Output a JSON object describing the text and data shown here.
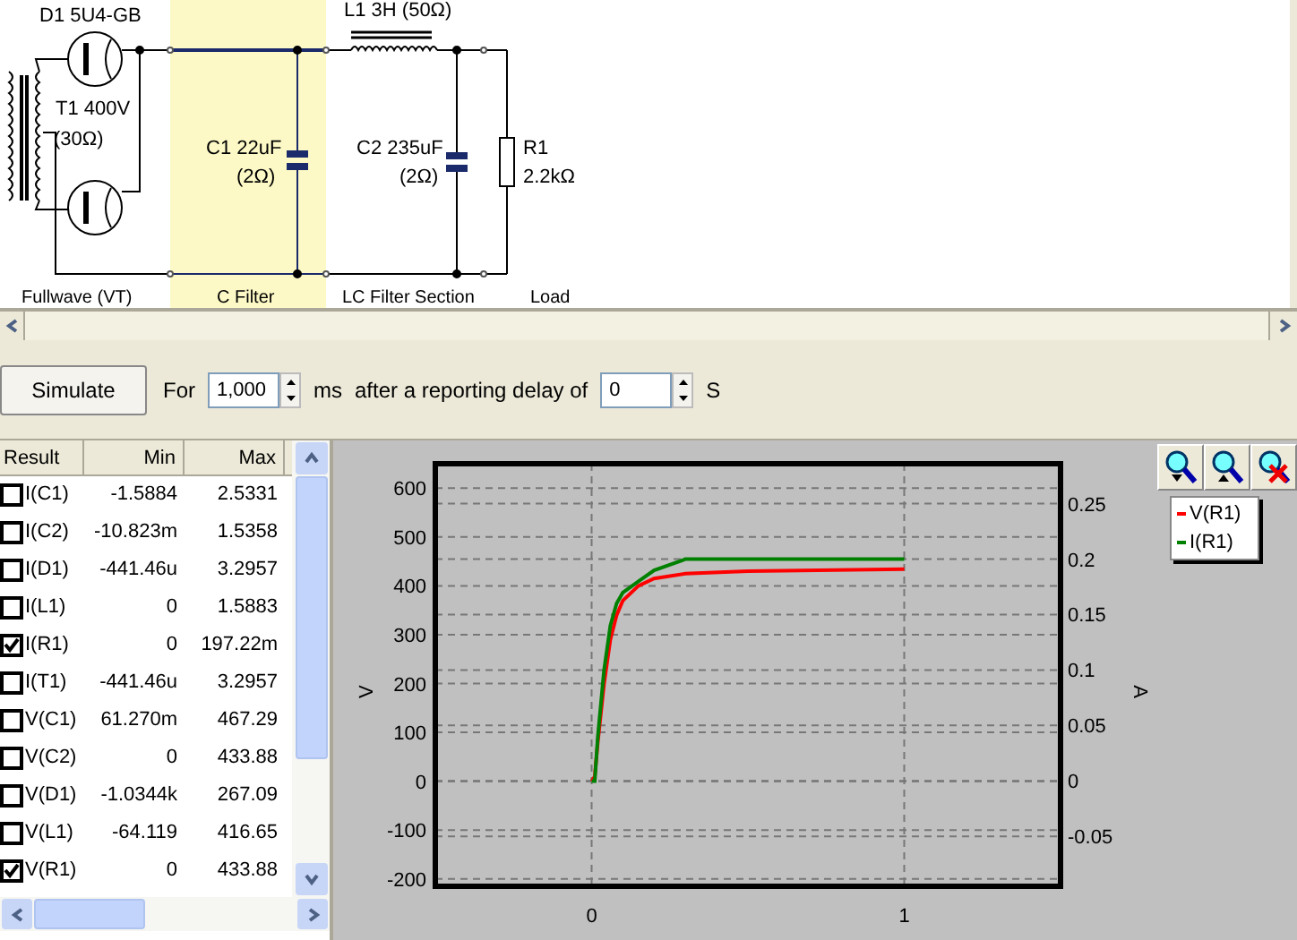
{
  "schematic": {
    "labels": [
      {
        "kind": "part",
        "text": "D1 5U4-GB"
      },
      {
        "kind": "part",
        "text": "T1 400V"
      },
      {
        "kind": "part",
        "text": "(30Ω)"
      },
      {
        "kind": "part",
        "text": "C1 22uF"
      },
      {
        "kind": "part",
        "text": "(2Ω)"
      },
      {
        "kind": "part",
        "text": "L1 3H (50Ω)"
      },
      {
        "kind": "part",
        "text": "C2 235uF"
      },
      {
        "kind": "part",
        "text": "(2Ω)"
      },
      {
        "kind": "part",
        "text": "R1"
      },
      {
        "kind": "part",
        "text": "2.2kΩ"
      }
    ],
    "sections": [
      {
        "label": "Fullwave (VT)",
        "selected": false
      },
      {
        "label": "C Filter",
        "selected": true
      },
      {
        "label": "LC Filter Section",
        "selected": false
      },
      {
        "label": "Load",
        "selected": false
      }
    ]
  },
  "toolbar": {
    "button": "Simulate",
    "for_label": "For",
    "duration": "1,000",
    "duration_unit": "ms",
    "delay_label": "after a reporting delay of",
    "delay": "0",
    "delay_unit": "S"
  },
  "results": {
    "columns": [
      "Result",
      "Min",
      "Max"
    ],
    "rows": [
      {
        "name": "I(C1)",
        "min": "-1.5884",
        "max": "2.5331",
        "checked": false
      },
      {
        "name": "I(C2)",
        "min": "-10.823m",
        "max": "1.5358",
        "checked": false
      },
      {
        "name": "I(D1)",
        "min": "-441.46u",
        "max": "3.2957",
        "checked": false
      },
      {
        "name": "I(L1)",
        "min": "0",
        "max": "1.5883",
        "checked": false
      },
      {
        "name": "I(R1)",
        "min": "0",
        "max": "197.22m",
        "checked": true
      },
      {
        "name": "I(T1)",
        "min": "-441.46u",
        "max": "3.2957",
        "checked": false
      },
      {
        "name": "V(C1)",
        "min": "61.270m",
        "max": "467.29",
        "checked": false
      },
      {
        "name": "V(C2)",
        "min": "0",
        "max": "433.88",
        "checked": false
      },
      {
        "name": "V(D1)",
        "min": "-1.0344k",
        "max": "267.09",
        "checked": false
      },
      {
        "name": "V(L1)",
        "min": "-64.119",
        "max": "416.65",
        "checked": false
      },
      {
        "name": "V(R1)",
        "min": "0",
        "max": "433.88",
        "checked": true
      }
    ]
  },
  "chart": {
    "chart_data": {
      "type": "line",
      "grid": true,
      "ylabel": "V",
      "y2label": "A",
      "x": [
        0,
        0.01,
        0.02,
        0.04,
        0.06,
        0.08,
        0.1,
        0.15,
        0.2,
        0.3,
        0.5,
        1
      ],
      "xlim": [
        -0.5,
        1.5
      ],
      "ylim": [
        -215,
        650
      ],
      "y2lim": [
        -0.095,
        0.286
      ],
      "xticks": [
        0,
        1
      ],
      "yticks": [
        -200,
        -100,
        0,
        100,
        200,
        300,
        400,
        500,
        600
      ],
      "y2ticks": [
        -0.05,
        0,
        0.05,
        0.1,
        0.15,
        0.2,
        0.25
      ],
      "series": [
        {
          "name": "V(R1)",
          "color": "#ff0000",
          "values": [
            0,
            10,
            80,
            200,
            290,
            340,
            370,
            400,
            415,
            425,
            430,
            434
          ]
        },
        {
          "name": "I(R1)",
          "color": "#008000",
          "axis": "y2",
          "values": [
            0,
            0,
            0.04,
            0.1,
            0.14,
            0.16,
            0.17,
            0.18,
            0.19,
            0.2,
            0.2,
            0.2
          ]
        }
      ]
    }
  }
}
